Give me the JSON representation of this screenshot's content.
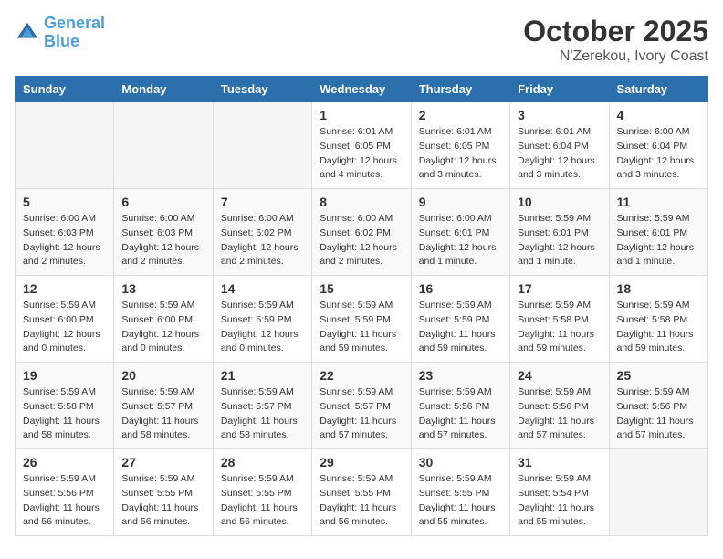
{
  "header": {
    "logo_line1": "General",
    "logo_line2": "Blue",
    "month": "October 2025",
    "location": "N'Zerekou, Ivory Coast"
  },
  "weekdays": [
    "Sunday",
    "Monday",
    "Tuesday",
    "Wednesday",
    "Thursday",
    "Friday",
    "Saturday"
  ],
  "weeks": [
    [
      {
        "day": "",
        "info": ""
      },
      {
        "day": "",
        "info": ""
      },
      {
        "day": "",
        "info": ""
      },
      {
        "day": "1",
        "info": "Sunrise: 6:01 AM\nSunset: 6:05 PM\nDaylight: 12 hours and 4 minutes."
      },
      {
        "day": "2",
        "info": "Sunrise: 6:01 AM\nSunset: 6:05 PM\nDaylight: 12 hours and 3 minutes."
      },
      {
        "day": "3",
        "info": "Sunrise: 6:01 AM\nSunset: 6:04 PM\nDaylight: 12 hours and 3 minutes."
      },
      {
        "day": "4",
        "info": "Sunrise: 6:00 AM\nSunset: 6:04 PM\nDaylight: 12 hours and 3 minutes."
      }
    ],
    [
      {
        "day": "5",
        "info": "Sunrise: 6:00 AM\nSunset: 6:03 PM\nDaylight: 12 hours and 2 minutes."
      },
      {
        "day": "6",
        "info": "Sunrise: 6:00 AM\nSunset: 6:03 PM\nDaylight: 12 hours and 2 minutes."
      },
      {
        "day": "7",
        "info": "Sunrise: 6:00 AM\nSunset: 6:02 PM\nDaylight: 12 hours and 2 minutes."
      },
      {
        "day": "8",
        "info": "Sunrise: 6:00 AM\nSunset: 6:02 PM\nDaylight: 12 hours and 2 minutes."
      },
      {
        "day": "9",
        "info": "Sunrise: 6:00 AM\nSunset: 6:01 PM\nDaylight: 12 hours and 1 minute."
      },
      {
        "day": "10",
        "info": "Sunrise: 5:59 AM\nSunset: 6:01 PM\nDaylight: 12 hours and 1 minute."
      },
      {
        "day": "11",
        "info": "Sunrise: 5:59 AM\nSunset: 6:01 PM\nDaylight: 12 hours and 1 minute."
      }
    ],
    [
      {
        "day": "12",
        "info": "Sunrise: 5:59 AM\nSunset: 6:00 PM\nDaylight: 12 hours and 0 minutes."
      },
      {
        "day": "13",
        "info": "Sunrise: 5:59 AM\nSunset: 6:00 PM\nDaylight: 12 hours and 0 minutes."
      },
      {
        "day": "14",
        "info": "Sunrise: 5:59 AM\nSunset: 5:59 PM\nDaylight: 12 hours and 0 minutes."
      },
      {
        "day": "15",
        "info": "Sunrise: 5:59 AM\nSunset: 5:59 PM\nDaylight: 11 hours and 59 minutes."
      },
      {
        "day": "16",
        "info": "Sunrise: 5:59 AM\nSunset: 5:59 PM\nDaylight: 11 hours and 59 minutes."
      },
      {
        "day": "17",
        "info": "Sunrise: 5:59 AM\nSunset: 5:58 PM\nDaylight: 11 hours and 59 minutes."
      },
      {
        "day": "18",
        "info": "Sunrise: 5:59 AM\nSunset: 5:58 PM\nDaylight: 11 hours and 59 minutes."
      }
    ],
    [
      {
        "day": "19",
        "info": "Sunrise: 5:59 AM\nSunset: 5:58 PM\nDaylight: 11 hours and 58 minutes."
      },
      {
        "day": "20",
        "info": "Sunrise: 5:59 AM\nSunset: 5:57 PM\nDaylight: 11 hours and 58 minutes."
      },
      {
        "day": "21",
        "info": "Sunrise: 5:59 AM\nSunset: 5:57 PM\nDaylight: 11 hours and 58 minutes."
      },
      {
        "day": "22",
        "info": "Sunrise: 5:59 AM\nSunset: 5:57 PM\nDaylight: 11 hours and 57 minutes."
      },
      {
        "day": "23",
        "info": "Sunrise: 5:59 AM\nSunset: 5:56 PM\nDaylight: 11 hours and 57 minutes."
      },
      {
        "day": "24",
        "info": "Sunrise: 5:59 AM\nSunset: 5:56 PM\nDaylight: 11 hours and 57 minutes."
      },
      {
        "day": "25",
        "info": "Sunrise: 5:59 AM\nSunset: 5:56 PM\nDaylight: 11 hours and 57 minutes."
      }
    ],
    [
      {
        "day": "26",
        "info": "Sunrise: 5:59 AM\nSunset: 5:56 PM\nDaylight: 11 hours and 56 minutes."
      },
      {
        "day": "27",
        "info": "Sunrise: 5:59 AM\nSunset: 5:55 PM\nDaylight: 11 hours and 56 minutes."
      },
      {
        "day": "28",
        "info": "Sunrise: 5:59 AM\nSunset: 5:55 PM\nDaylight: 11 hours and 56 minutes."
      },
      {
        "day": "29",
        "info": "Sunrise: 5:59 AM\nSunset: 5:55 PM\nDaylight: 11 hours and 56 minutes."
      },
      {
        "day": "30",
        "info": "Sunrise: 5:59 AM\nSunset: 5:55 PM\nDaylight: 11 hours and 55 minutes."
      },
      {
        "day": "31",
        "info": "Sunrise: 5:59 AM\nSunset: 5:54 PM\nDaylight: 11 hours and 55 minutes."
      },
      {
        "day": "",
        "info": ""
      }
    ]
  ]
}
